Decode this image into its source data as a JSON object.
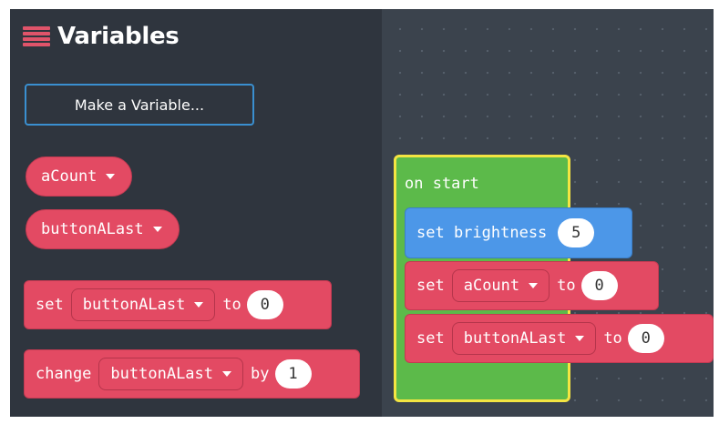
{
  "flyout": {
    "category_title": "Variables",
    "make_variable_label": "Make a Variable...",
    "variable_reporters": [
      "aCount",
      "buttonALast"
    ],
    "set_block": {
      "keyword": "set",
      "variable": "buttonALast",
      "to_label": "to",
      "value": "0"
    },
    "change_block": {
      "keyword": "change",
      "variable": "buttonALast",
      "by_label": "by",
      "value": "1"
    }
  },
  "workspace": {
    "on_start_label": "on start",
    "brightness_block": {
      "label": "set brightness",
      "value": "5"
    },
    "set_acount": {
      "keyword": "set",
      "variable": "aCount",
      "to_label": "to",
      "value": "0"
    },
    "set_buttonalast": {
      "keyword": "set",
      "variable": "buttonALast",
      "to_label": "to",
      "value": "0"
    }
  },
  "colors": {
    "variables": "#e34a63",
    "basic": "#4c97e8",
    "events": "#5cba4a",
    "selection_outline": "#f4e542",
    "flyout_bg": "#2f353e",
    "workspace_bg": "#3b434d"
  }
}
